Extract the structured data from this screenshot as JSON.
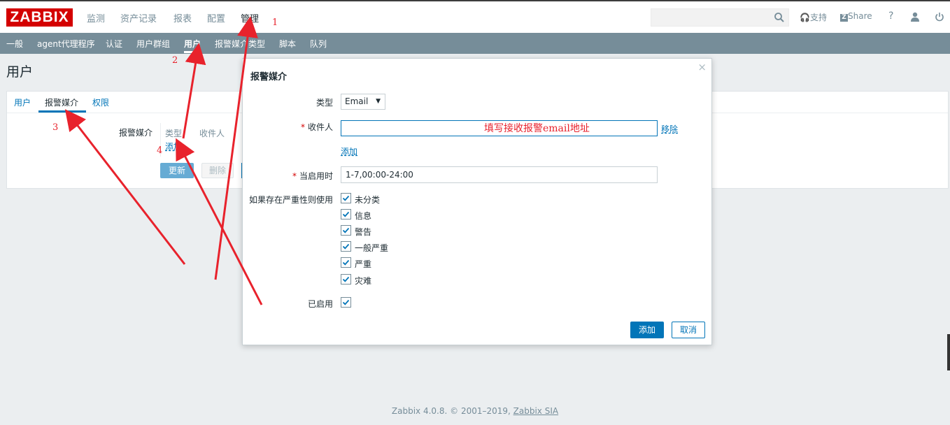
{
  "logo": "ZABBIX",
  "main_nav": [
    "监测",
    "资产记录",
    "报表",
    "配置",
    "管理"
  ],
  "top_right": {
    "support": "支持",
    "share": "Share",
    "help": "?"
  },
  "sub_nav": [
    "一般",
    "agent代理程序",
    "认证",
    "用户群组",
    "用户",
    "报警媒介类型",
    "脚本",
    "队列"
  ],
  "page_title": "用户",
  "form": {
    "tabs": [
      "用户",
      "报警媒介",
      "权限"
    ],
    "media_label": "报警媒介",
    "col_type": "类型",
    "col_recipient": "收件人",
    "add_link": "添加",
    "update_btn": "更新",
    "delete_btn": "删除"
  },
  "dialog": {
    "title": "报警媒介",
    "close": "×",
    "type_label": "类型",
    "type_value": "Email",
    "recipient_label": "收件人",
    "remove_link": "移除",
    "add_link": "添加",
    "when_active_label": "当启用时",
    "when_active_value": "1-7,00:00-24:00",
    "severity_label": "如果存在严重性则使用",
    "severities": [
      "未分类",
      "信息",
      "警告",
      "一般严重",
      "严重",
      "灾难"
    ],
    "enabled_label": "已启用",
    "add_btn": "添加",
    "cancel_btn": "取消"
  },
  "footer": {
    "text": "Zabbix 4.0.8. © 2001–2019, ",
    "link": "Zabbix SIA"
  },
  "annotations": {
    "n1": "1",
    "n2": "2",
    "n3": "3",
    "n4": "4",
    "hint": "填写接收报警email地址",
    "color": "#e8222c"
  },
  "colors": {
    "accent": "#0275b8",
    "subnav": "#768d99",
    "logo": "#d40000"
  }
}
